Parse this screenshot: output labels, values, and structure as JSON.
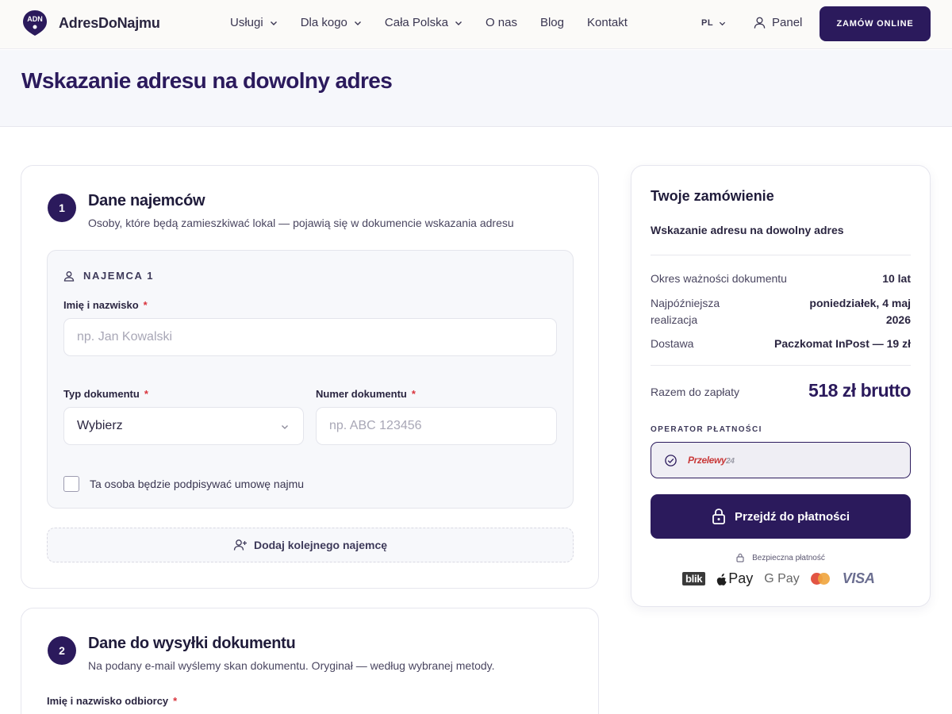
{
  "brand": {
    "name": "AdresDoNajmu",
    "accent": "#2b1a5c"
  },
  "nav": {
    "items": [
      {
        "label": "Usługi",
        "has_dropdown": true
      },
      {
        "label": "Dla kogo",
        "has_dropdown": true
      },
      {
        "label": "Cała Polska",
        "has_dropdown": true
      },
      {
        "label": "O nas",
        "has_dropdown": false
      },
      {
        "label": "Blog",
        "has_dropdown": false
      },
      {
        "label": "Kontakt",
        "has_dropdown": false
      }
    ],
    "language": "PL",
    "panel_label": "Panel",
    "order_button": "ZAMÓW ONLINE"
  },
  "page": {
    "title": "Wskazanie adresu na dowolny adres"
  },
  "section1": {
    "step": "1",
    "title": "Dane najemców",
    "subtitle": "Osoby, które będą zamieszkiwać lokal — pojawią się w dokumencie wskazania adresu",
    "tenant": {
      "heading": "NAJEMCA 1",
      "name_label": "Imię i nazwisko",
      "name_placeholder": "np. Jan Kowalski",
      "doc_type_label": "Typ dokumentu",
      "doc_type_value": "Wybierz",
      "doc_number_label": "Numer dokumentu",
      "doc_number_placeholder": "np. ABC 123456",
      "signer_checkbox_label": "Ta osoba będzie podpisywać umowę najmu",
      "signer_checked": false
    },
    "add_tenant_label": "Dodaj kolejnego najemcę"
  },
  "section2": {
    "step": "2",
    "title": "Dane do wysyłki dokumentu",
    "subtitle": "Na podany e-mail wyślemy skan dokumentu. Oryginał — według wybranej metody.",
    "recipient_label": "Imię i nazwisko odbiorcy"
  },
  "required_marker": "*",
  "summary": {
    "title": "Twoje zamówienie",
    "product": "Wskazanie adresu na dowolny adres",
    "rows": [
      {
        "label": "Okres ważności dokumentu",
        "value": "10 lat"
      },
      {
        "label": "Najpóźniejsza realizacja",
        "value": "poniedziałek, 4 maj 2026"
      },
      {
        "label": "Dostawa",
        "value": "Paczkomat InPost — 19 zł"
      }
    ],
    "total_label": "Razem do zapłaty",
    "total_value": "518 zł brutto",
    "operator_label": "OPERATOR PŁATNOŚCI",
    "operator_name": "Przelewy",
    "operator_suffix": "24",
    "pay_button": "Przejdź do płatności",
    "secure_label": "Bezpieczna płatność",
    "payment_logos": {
      "blik": "blik",
      "apple": "Pay",
      "google": "G Pay",
      "visa": "VISA"
    }
  }
}
